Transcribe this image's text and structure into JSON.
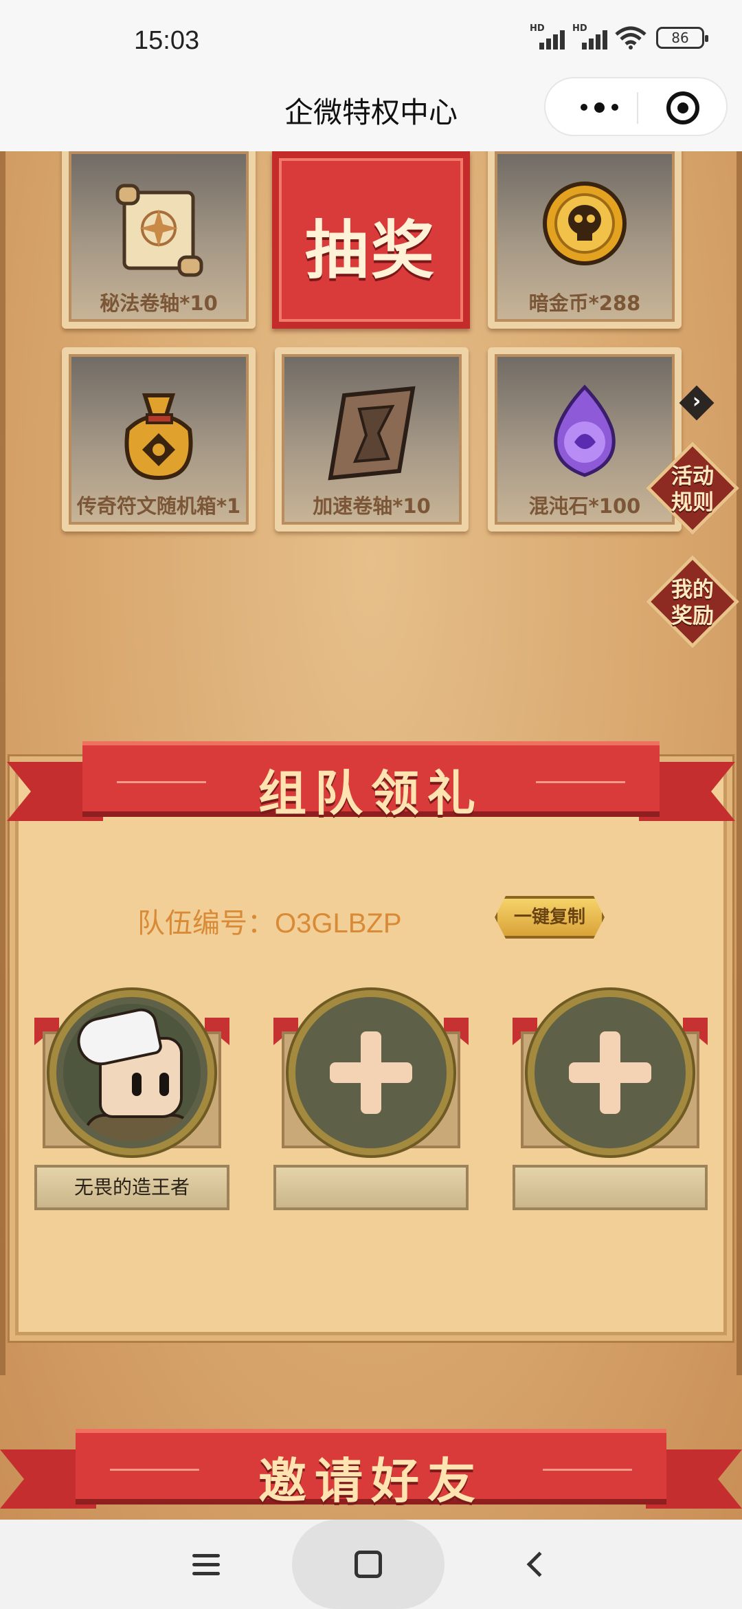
{
  "status_bar": {
    "time": "15:03",
    "signal1_label": "HD",
    "signal2_label": "HD",
    "battery": "86"
  },
  "nav": {
    "title": "企微特权中心"
  },
  "prizes": [
    {
      "label": "秘法卷轴*10",
      "icon": "scroll-icon"
    },
    {
      "label": "抽奖",
      "icon": "lottery-button"
    },
    {
      "label": "暗金币*288",
      "icon": "skull-coin-icon"
    },
    {
      "label": "传奇符文随机箱*1",
      "icon": "rune-bag-icon"
    },
    {
      "label": "加速卷轴*10",
      "icon": "hourglass-scroll-icon"
    },
    {
      "label": "混沌石*100",
      "icon": "chaos-stone-icon"
    }
  ],
  "side_menu": {
    "rules": "活动\n规则",
    "rewards": "我的\n奖励"
  },
  "team": {
    "ribbon_title": "组队领礼",
    "team_id": "队伍编号：O3GLBZP",
    "copy_button": "一键复制",
    "slots": [
      {
        "name": "无畏的造王者",
        "filled": true
      },
      {
        "name": "",
        "filled": false
      },
      {
        "name": "",
        "filled": false
      }
    ]
  },
  "invite": {
    "ribbon_title": "邀请好友"
  },
  "colors": {
    "ribbon_red": "#d93a3a",
    "panel_tan": "#f1cf96",
    "team_id_orange": "#d98a36"
  }
}
